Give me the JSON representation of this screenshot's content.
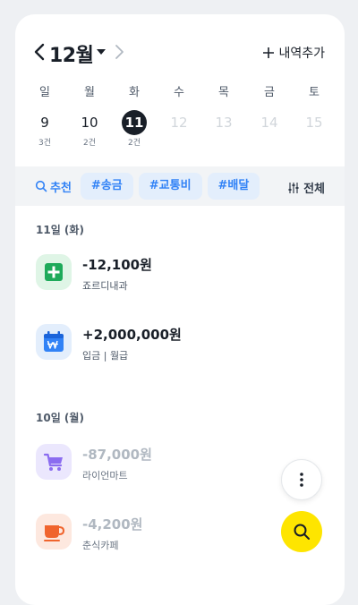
{
  "header": {
    "month": "12월",
    "add_label": "내역추가"
  },
  "week": {
    "days": [
      {
        "dow": "일",
        "date": "9",
        "count": "3건",
        "state": "past"
      },
      {
        "dow": "월",
        "date": "10",
        "count": "2건",
        "state": "past"
      },
      {
        "dow": "화",
        "date": "11",
        "count": "2건",
        "state": "selected"
      },
      {
        "dow": "수",
        "date": "12",
        "count": "",
        "state": "future"
      },
      {
        "dow": "목",
        "date": "13",
        "count": "",
        "state": "future"
      },
      {
        "dow": "금",
        "date": "14",
        "count": "",
        "state": "future"
      },
      {
        "dow": "토",
        "date": "15",
        "count": "",
        "state": "future"
      }
    ]
  },
  "filters": {
    "recommend_label": "추천",
    "chips": [
      "#송금",
      "#교통비",
      "#배달"
    ],
    "all_label": "전체"
  },
  "sections": [
    {
      "title": "11일 (화)",
      "items": [
        {
          "icon": "hospital-cross-icon",
          "amount": "-12,100원",
          "desc": "죠르디내과",
          "icon_bg": "#dff5e6",
          "icon_fg": "#1eaa5a",
          "dim": false
        },
        {
          "icon": "calendar-won-icon",
          "amount": "+2,000,000원",
          "desc": "입금 | 월급",
          "icon_bg": "#e3eefc",
          "icon_fg": "#3182f6",
          "dim": false
        }
      ]
    },
    {
      "title": "10일 (월)",
      "items": [
        {
          "icon": "shopping-cart-icon",
          "amount": "-87,000원",
          "desc": "라이언마트",
          "icon_bg": "#ebe7fd",
          "icon_fg": "#8b6cf0",
          "dim": true
        },
        {
          "icon": "coffee-cup-icon",
          "amount": "-4,200원",
          "desc": "춘식카페",
          "icon_bg": "#fde8df",
          "icon_fg": "#f0642d",
          "dim": true
        }
      ]
    }
  ],
  "colors": {
    "accent": "#3182f6",
    "fab_yellow": "#fee500",
    "selected_day": "#191f28"
  }
}
